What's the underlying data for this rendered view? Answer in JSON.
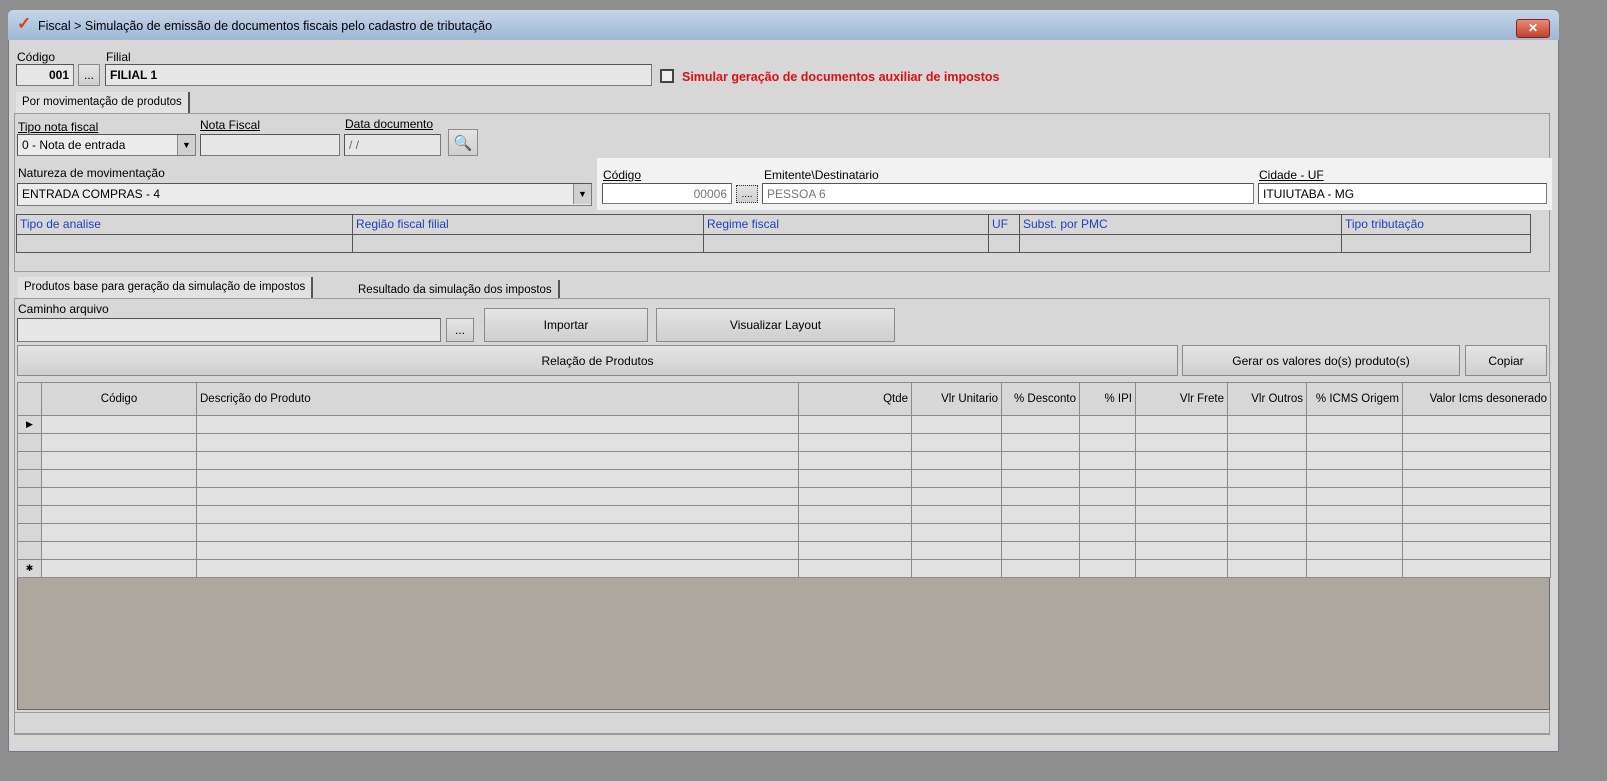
{
  "window": {
    "title": "Fiscal > Simulação de emissão de documentos fiscais pelo cadastro de tributação",
    "close": "✕"
  },
  "filial": {
    "codigo_label": "Código",
    "codigo_value": "001",
    "browse": "...",
    "filial_label": "Filial",
    "filial_value": "FILIAL 1",
    "simular_label": "Simular geração de documentos auxiliar de impostos"
  },
  "top_tab": "Por movimentação de produtos",
  "form": {
    "tipo_label": "Tipo nota fiscal",
    "tipo_value": "0 - Nota de entrada",
    "nota_label": "Nota Fiscal",
    "nota_value": "",
    "data_label": "Data documento",
    "data_value": " / /",
    "natureza_label": "Natureza de movimentação",
    "natureza_value": "ENTRADA COMPRAS - 4"
  },
  "emitente": {
    "codigo_label": "Código",
    "codigo_value": "00006",
    "browse": "....",
    "nome_label": "Emitente\\Destinatario",
    "nome_value": "PESSOA 6",
    "cidade_label": "Cidade - UF",
    "cidade_value": "ITUIUTABA - MG"
  },
  "analysis_headers": [
    "Tipo de analise",
    "Região fiscal filial",
    "Regime fiscal",
    "UF",
    "Subst. por PMC",
    "Tipo tributação"
  ],
  "tabs": [
    "Produtos base para geração da simulação de impostos",
    "Resultado da simulação dos impostos"
  ],
  "import": {
    "caminho_label": "Caminho arquivo",
    "caminho_value": "",
    "browse": "...",
    "importar": "Importar",
    "visualizar": "Visualizar Layout"
  },
  "actions": {
    "relacao": "Relação de Produtos",
    "gerar": "Gerar os valores do(s) produto(s)",
    "copiar": "Copiar"
  },
  "grid": {
    "columns": [
      "Código",
      "Descrição do Produto",
      "Qtde",
      "Vlr Unitario",
      "% Desconto",
      "% IPI",
      "Vlr Frete",
      "Vlr Outros",
      "% ICMS Origem",
      "Valor Icms desonerado"
    ],
    "current_marker": "▶",
    "new_marker": "✱"
  },
  "colors": {
    "accent_red": "#e01010",
    "header_blue": "#1f3fbf"
  }
}
